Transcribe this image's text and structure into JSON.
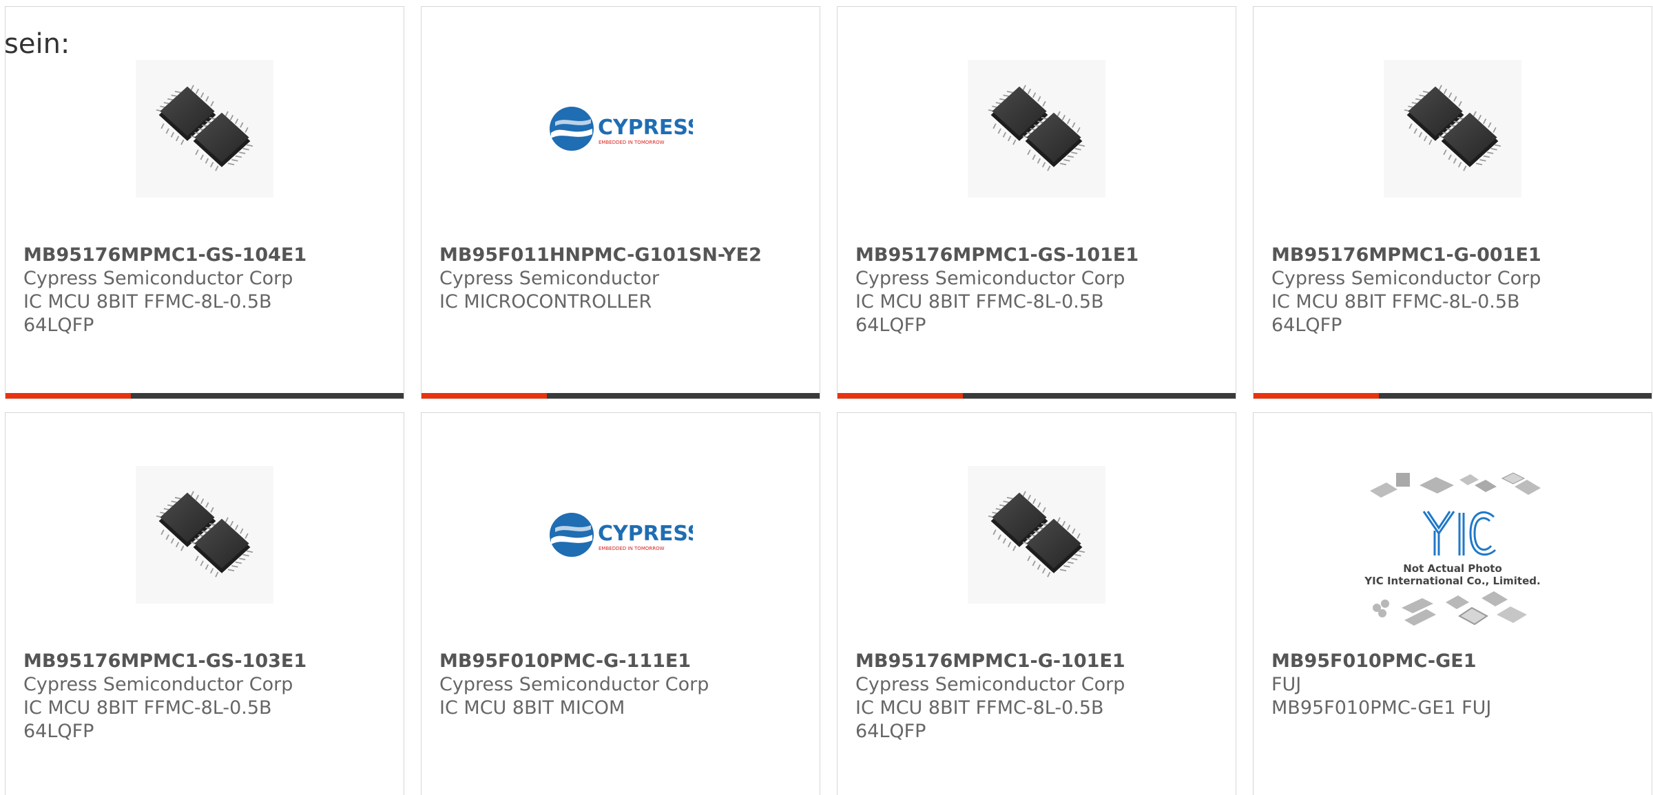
{
  "intro_text": "sein:",
  "colors": {
    "accent": "#e8330d",
    "bar": "#3a3a3a",
    "border": "#d6d6d6",
    "cypress_blue": "#1f6db3",
    "cypress_red": "#d92020"
  },
  "products": [
    {
      "part": "MB95176MPMC1-GS-104E1",
      "manufacturer": "Cypress Semiconductor Corp",
      "description": "IC MCU 8BIT FFMC-8L-0.5B 64LQFP",
      "image": "lqfp-chips-photo"
    },
    {
      "part": "MB95F011HNPMC-G101SN-YE2",
      "manufacturer": "Cypress Semiconductor",
      "description": "IC MICROCONTROLLER",
      "image": "cypress-logo",
      "logo_text": "CYPRESS",
      "logo_tagline": "EMBEDDED IN TOMORROW"
    },
    {
      "part": "MB95176MPMC1-GS-101E1",
      "manufacturer": "Cypress Semiconductor Corp",
      "description": "IC MCU 8BIT FFMC-8L-0.5B 64LQFP",
      "image": "lqfp-chips-photo"
    },
    {
      "part": "MB95176MPMC1-G-001E1",
      "manufacturer": "Cypress Semiconductor Corp",
      "description": "IC MCU 8BIT FFMC-8L-0.5B 64LQFP",
      "image": "lqfp-chips-photo"
    },
    {
      "part": "MB95176MPMC1-GS-103E1",
      "manufacturer": "Cypress Semiconductor Corp",
      "description": "IC MCU 8BIT FFMC-8L-0.5B 64LQFP",
      "image": "lqfp-chips-photo"
    },
    {
      "part": "MB95F010PMC-G-111E1",
      "manufacturer": "Cypress Semiconductor Corp",
      "description": "IC MCU 8BIT MICOM",
      "image": "cypress-logo",
      "logo_text": "CYPRESS",
      "logo_tagline": "EMBEDDED IN TOMORROW"
    },
    {
      "part": "MB95176MPMC1-G-101E1",
      "manufacturer": "Cypress Semiconductor Corp",
      "description": "IC MCU 8BIT FFMC-8L-0.5B 64LQFP",
      "image": "lqfp-chips-photo"
    },
    {
      "part": "MB95F010PMC-GE1",
      "manufacturer": "FUJ",
      "description": "MB95F010PMC-GE1 FUJ",
      "image": "yic-placeholder",
      "placeholder_line1": "Not Actual Photo",
      "placeholder_line2": "YIC International Co., Limited."
    }
  ]
}
